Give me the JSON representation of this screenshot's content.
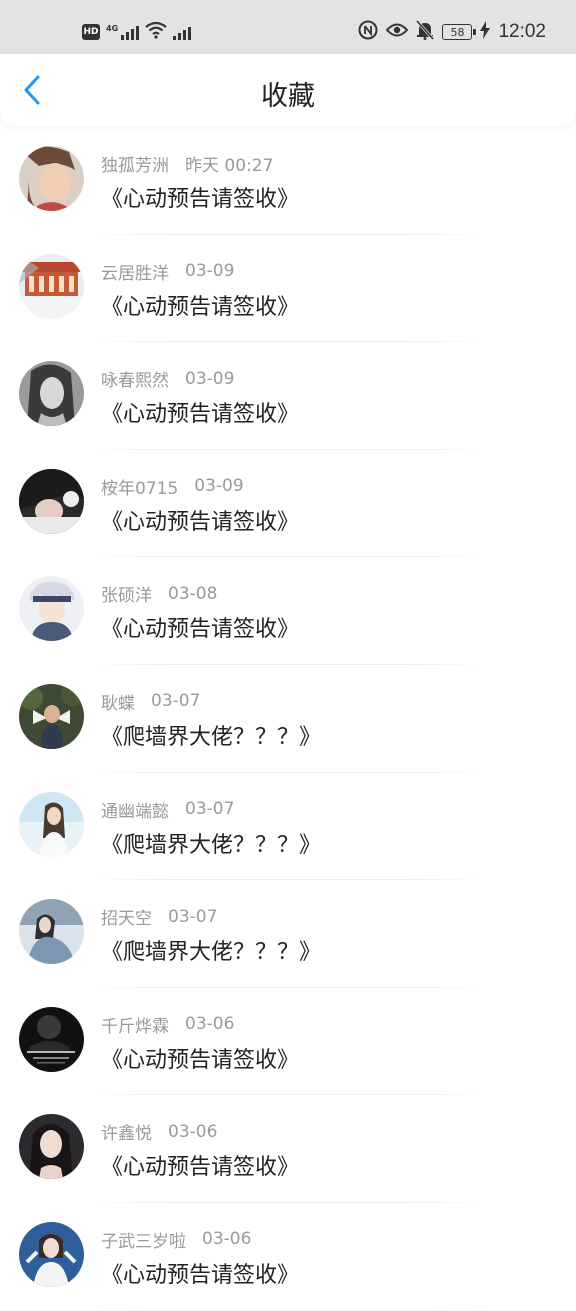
{
  "status": {
    "left_badge": "HD",
    "net_label": "4G",
    "battery": "58",
    "time": "12:02"
  },
  "header": {
    "title": "收藏"
  },
  "theme": {
    "accent": "#2196f3"
  },
  "items": [
    {
      "name": "独孤芳洲",
      "time": "昨天 00:27",
      "content": "《心动预告请签收》"
    },
    {
      "name": "云居胜洋",
      "time": "03-09",
      "content": "《心动预告请签收》"
    },
    {
      "name": "咏春熙然",
      "time": "03-09",
      "content": "《心动预告请签收》"
    },
    {
      "name": "桉年0715",
      "time": "03-09",
      "content": "《心动预告请签收》"
    },
    {
      "name": "张硕洋",
      "time": "03-08",
      "content": "《心动预告请签收》"
    },
    {
      "name": "耿蝶",
      "time": "03-07",
      "content": "《爬墙界大佬？？？》"
    },
    {
      "name": "通幽端懿",
      "time": "03-07",
      "content": "《爬墙界大佬？？？》"
    },
    {
      "name": "招天空",
      "time": "03-07",
      "content": "《爬墙界大佬？？？》"
    },
    {
      "name": "千斤烨霖",
      "time": "03-06",
      "content": "《心动预告请签收》"
    },
    {
      "name": "许鑫悦",
      "time": "03-06",
      "content": "《心动预告请签收》"
    },
    {
      "name": "子武三岁啦",
      "time": "03-06",
      "content": "《心动预告请签收》"
    }
  ]
}
